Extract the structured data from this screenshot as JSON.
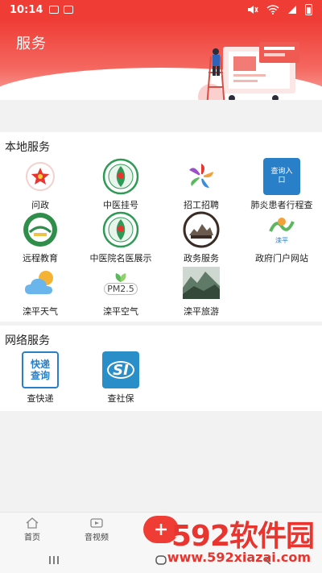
{
  "status_bar": {
    "time": "10:14"
  },
  "header": {
    "title": "服务"
  },
  "local_services": {
    "title": "本地服务",
    "items": [
      {
        "label": "问政",
        "icon": "star-badge-icon"
      },
      {
        "label": "中医挂号",
        "icon": "tcm-emblem-icon"
      },
      {
        "label": "招工招聘",
        "icon": "recruit-pinwheel-icon"
      },
      {
        "label": "肺炎患者行程查",
        "icon": "query-entry-icon",
        "icon_text": "查询入口"
      },
      {
        "label": "远程教育",
        "icon": "education-emblem-icon"
      },
      {
        "label": "中医院名医展示",
        "icon": "tcm-emblem-icon"
      },
      {
        "label": "政务服务",
        "icon": "great-wall-emblem-icon"
      },
      {
        "label": "政府门户网站",
        "icon": "government-portal-icon",
        "icon_text": "滦平"
      },
      {
        "label": "滦平天气",
        "icon": "weather-cloud-icon"
      },
      {
        "label": "滦平空气",
        "icon": "air-pm25-icon",
        "icon_text": "PM2.5"
      },
      {
        "label": "滦平旅游",
        "icon": "mountain-photo-icon"
      }
    ]
  },
  "network_services": {
    "title": "网络服务",
    "items": [
      {
        "label": "查快递",
        "icon": "express-query-icon",
        "icon_text": "快递查询"
      },
      {
        "label": "查社保",
        "icon": "social-security-icon",
        "icon_text": "SI"
      }
    ]
  },
  "tabbar": {
    "tabs": [
      {
        "label": "首页",
        "icon": "home-icon"
      },
      {
        "label": "音视频",
        "icon": "video-icon"
      }
    ]
  },
  "watermark": {
    "main": "592软件园",
    "sub": "www.592xiazai.com"
  },
  "colors": {
    "brand_red": "#ef3c35",
    "icon_blue": "#2a7fc9"
  }
}
